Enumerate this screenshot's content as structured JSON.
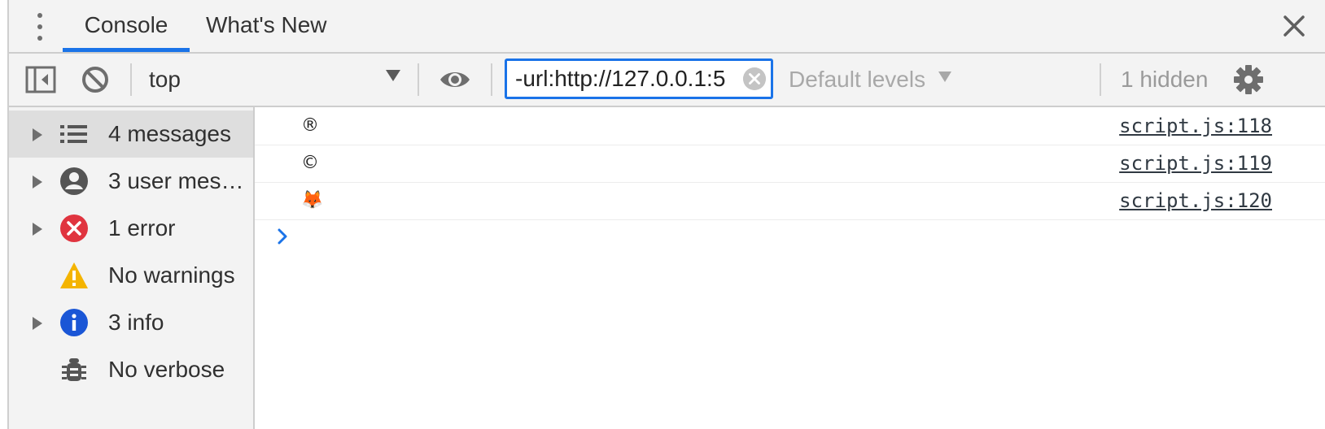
{
  "tabs": [
    {
      "label": "Console",
      "active": true
    },
    {
      "label": "What's New",
      "active": false
    }
  ],
  "toolbar": {
    "context": "top",
    "filter_value": "-url:http://127.0.0.1:5",
    "levels_label": "Default levels",
    "hidden_label": "1 hidden"
  },
  "sidebar": {
    "items": [
      {
        "label": "4 messages",
        "icon": "list-icon",
        "expandable": true,
        "selected": true
      },
      {
        "label": "3 user messages",
        "icon": "user-icon",
        "expandable": true,
        "selected": false
      },
      {
        "label": "1 error",
        "icon": "error-icon",
        "expandable": true,
        "selected": false
      },
      {
        "label": "No warnings",
        "icon": "warning-icon",
        "expandable": false,
        "selected": false
      },
      {
        "label": "3 info",
        "icon": "info-icon",
        "expandable": true,
        "selected": false
      },
      {
        "label": "No verbose",
        "icon": "bug-icon",
        "expandable": false,
        "selected": false
      }
    ]
  },
  "console": {
    "messages": [
      {
        "text": "®",
        "source": "script.js:118"
      },
      {
        "text": "©",
        "source": "script.js:119"
      },
      {
        "text": "🦊",
        "source": "script.js:120"
      }
    ]
  },
  "colors": {
    "accent": "#1a73e8",
    "error": "#e0343f",
    "warning": "#f4b400",
    "info": "#1a56d6",
    "panel_bg": "#f3f3f3"
  }
}
